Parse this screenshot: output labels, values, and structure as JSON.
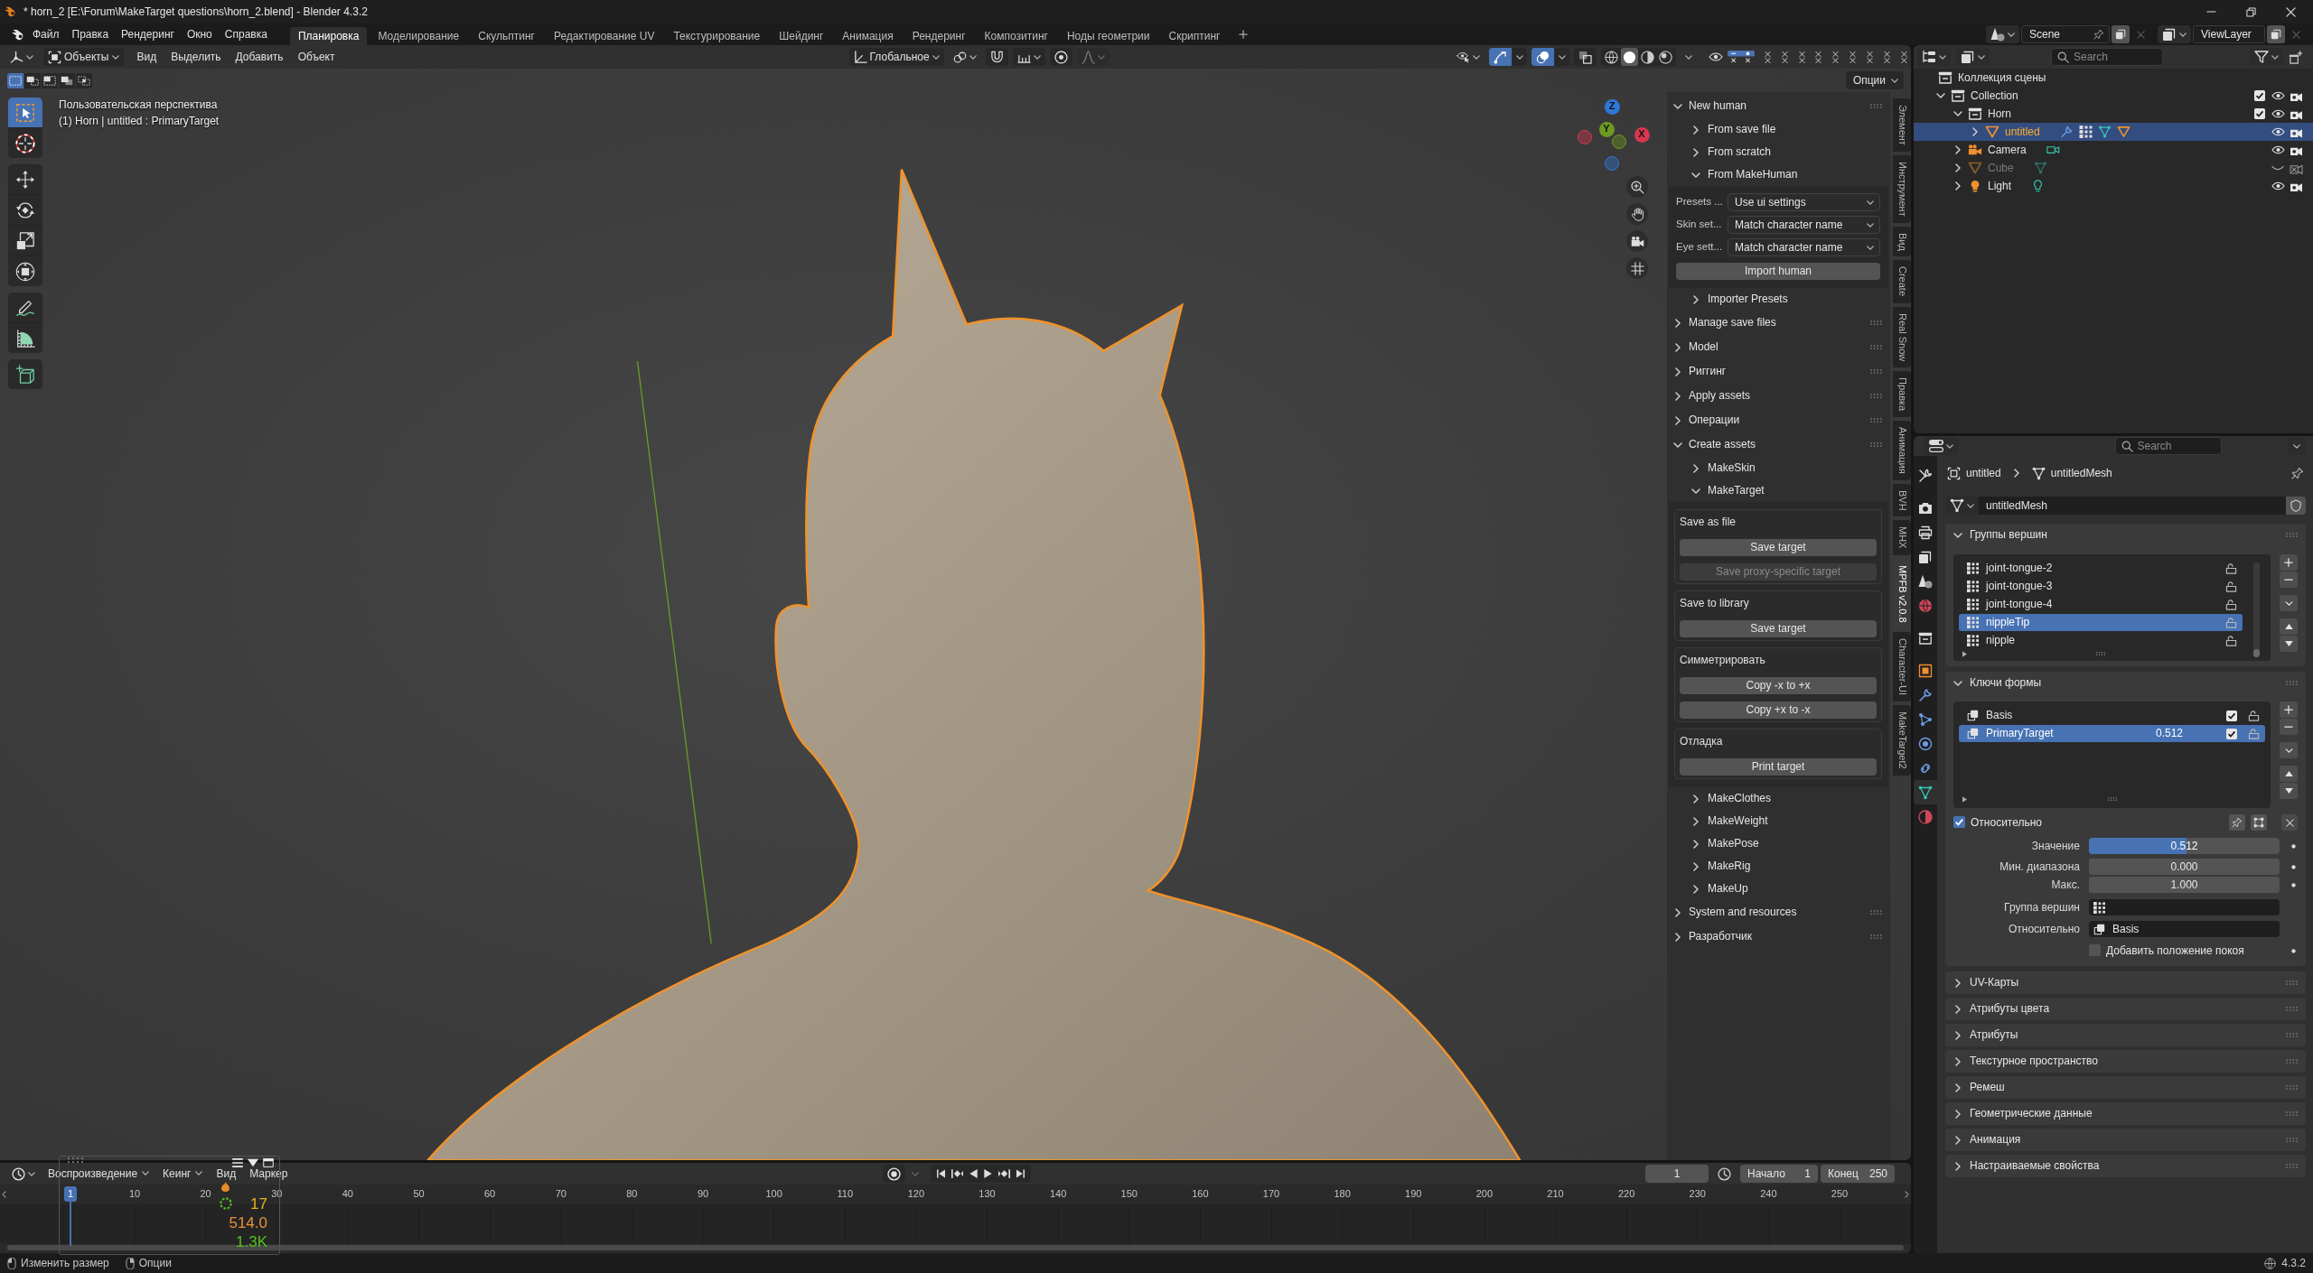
{
  "window": {
    "title": "* horn_2 [E:\\Forum\\MakeTarget questions\\horn_2.blend] - Blender 4.3.2"
  },
  "menu": [
    "Файл",
    "Правка",
    "Рендеринг",
    "Окно",
    "Справка"
  ],
  "workspaces": [
    {
      "label": "Планировка",
      "selected": true
    },
    {
      "label": "Моделирование",
      "selected": false
    },
    {
      "label": "Скульптинг",
      "selected": false
    },
    {
      "label": "Редактирование UV",
      "selected": false
    },
    {
      "label": "Текстурирование",
      "selected": false
    },
    {
      "label": "Шейдинг",
      "selected": false
    },
    {
      "label": "Анимация",
      "selected": false
    },
    {
      "label": "Рендеринг",
      "selected": false
    },
    {
      "label": "Композитинг",
      "selected": false
    },
    {
      "label": "Ноды геометрии",
      "selected": false
    },
    {
      "label": "Скриптинг",
      "selected": false
    }
  ],
  "scene": {
    "name": "Scene"
  },
  "view_layer": {
    "name": "ViewLayer"
  },
  "viewport": {
    "mode": "Объекты",
    "menus": [
      "Вид",
      "Выделить",
      "Добавить",
      "Объект"
    ],
    "orientation": "Глобальное",
    "toggles": [
      {
        "kind": "gizmo",
        "on": true
      },
      {
        "kind": "overlays",
        "on": true
      },
      {
        "kind": "xray",
        "on": false
      }
    ],
    "shading": [
      {
        "kind": "wireframe",
        "selected": false
      },
      {
        "kind": "solid",
        "selected": true
      },
      {
        "kind": "material",
        "selected": false
      },
      {
        "kind": "rendered",
        "selected": false
      }
    ],
    "options": "Опции",
    "select_modes": [
      {
        "kind": "new",
        "selected": true
      },
      {
        "kind": "extend",
        "selected": false
      },
      {
        "kind": "subtract",
        "selected": false
      },
      {
        "kind": "invert",
        "selected": false
      },
      {
        "kind": "intersect",
        "selected": false
      }
    ],
    "tool_groups": [
      [
        {
          "kind": "select_box",
          "selected": true
        },
        {
          "kind": "cursor",
          "selected": false
        }
      ],
      [
        {
          "kind": "move",
          "selected": false
        },
        {
          "kind": "rotate",
          "selected": false
        },
        {
          "kind": "scale",
          "selected": false
        },
        {
          "kind": "transform",
          "selected": false
        }
      ],
      [
        {
          "kind": "annotate",
          "selected": false
        },
        {
          "kind": "measure",
          "selected": false
        }
      ],
      [
        {
          "kind": "add_cube",
          "selected": false
        }
      ]
    ],
    "info": [
      "Пользовательская перспектива",
      "(1) Horn | untitled : PrimaryTarget"
    ],
    "axes": [
      {
        "label": "Z",
        "color": "#2f78d8"
      },
      {
        "label": "Y",
        "color": "#6c9a22"
      },
      {
        "label": "X",
        "color": "#d8364e"
      }
    ],
    "sidebar": {
      "panels": [
        {
          "title": "New human",
          "expanded": true,
          "children": [
            {
              "title": "From save file",
              "expanded": false
            },
            {
              "title": "From scratch",
              "expanded": false
            },
            {
              "title": "From MakeHuman",
              "expanded": true,
              "fields": [
                {
                  "label": "Presets ...",
                  "value": "Use ui settings"
                },
                {
                  "label": "Skin set...",
                  "value": "Match character name"
                },
                {
                  "label": "Eye sett...",
                  "value": "Match character name"
                }
              ],
              "buttons": [
                {
                  "label": "Import human",
                  "disabled": false
                }
              ]
            },
            {
              "title": "Importer Presets",
              "expanded": false
            }
          ]
        },
        {
          "title": "Manage save files",
          "expanded": false
        },
        {
          "title": "Model",
          "expanded": false
        },
        {
          "title": "Риггинг",
          "expanded": false
        },
        {
          "title": "Apply assets",
          "expanded": false
        },
        {
          "title": "Операции",
          "expanded": false
        },
        {
          "title": "Create assets",
          "expanded": true,
          "children": [
            {
              "title": "MakeSkin",
              "expanded": false
            },
            {
              "title": "MakeTarget",
              "expanded": true,
              "boxes": [
                {
                  "title": "Save as file",
                  "buttons": [
                    {
                      "label": "Save target",
                      "disabled": false
                    },
                    {
                      "label": "Save proxy-specific target",
                      "disabled": true
                    }
                  ]
                },
                {
                  "title": "Save to library",
                  "buttons": [
                    {
                      "label": "Save target",
                      "disabled": false
                    }
                  ]
                },
                {
                  "title": "Симметрировать",
                  "buttons": [
                    {
                      "label": "Copy -x to +x",
                      "disabled": false
                    },
                    {
                      "label": "Copy +x to -x",
                      "disabled": false
                    }
                  ]
                },
                {
                  "title": "Отладка",
                  "buttons": [
                    {
                      "label": "Print target",
                      "disabled": false
                    }
                  ]
                }
              ]
            },
            {
              "title": "MakeClothes",
              "expanded": false
            },
            {
              "title": "MakeWeight",
              "expanded": false
            },
            {
              "title": "MakePose",
              "expanded": false
            },
            {
              "title": "MakeRig",
              "expanded": false
            },
            {
              "title": "MakeUp",
              "expanded": false
            }
          ]
        },
        {
          "title": "System and resources",
          "expanded": false
        },
        {
          "title": "Разработчик",
          "expanded": false
        }
      ],
      "tabs": [
        {
          "label": "Элемент",
          "selected": false
        },
        {
          "label": "Инструмент",
          "selected": false
        },
        {
          "label": "Вид",
          "selected": false
        },
        {
          "label": "Create",
          "selected": false
        },
        {
          "label": "Real Snow",
          "selected": false
        },
        {
          "label": "Правка",
          "selected": false
        },
        {
          "label": "Анимация",
          "selected": false
        },
        {
          "label": "BVH",
          "selected": false
        },
        {
          "label": "MHX",
          "selected": false
        },
        {
          "label": "MPFB v2.0.8",
          "selected": true
        },
        {
          "label": "Character-UI",
          "selected": false
        },
        {
          "label": "MakeTarget2",
          "selected": false
        }
      ]
    }
  },
  "outliner": {
    "search": {
      "placeholder": "Search"
    },
    "root": {
      "name": "Коллекция сцены"
    },
    "tree": [
      {
        "name": "Collection",
        "kind": "collection",
        "expanded": true,
        "selected": false,
        "checked": true,
        "hidden": false,
        "renderable": true,
        "children": [
          {
            "name": "Horn",
            "kind": "collection",
            "expanded": true,
            "selected": false,
            "checked": true,
            "hidden": false,
            "renderable": true,
            "children": [
              {
                "name": "untitled",
                "kind": "mesh",
                "expanded": false,
                "selected": true,
                "hidden": false,
                "renderable": true,
                "extras": [
                  {
                    "kind": "modifier"
                  },
                  {
                    "kind": "vertex_groups"
                  },
                  {
                    "kind": "mesh_data"
                  },
                  {
                    "kind": "mesh_object"
                  }
                ]
              }
            ]
          },
          {
            "name": "Camera",
            "kind": "camera",
            "expanded": false,
            "selected": false,
            "hidden": false,
            "renderable": true,
            "extras": [
              {
                "kind": "camera_data"
              }
            ]
          },
          {
            "name": "Cube",
            "kind": "mesh",
            "expanded": false,
            "selected": false,
            "hidden": true,
            "renderable": false,
            "extras": [
              {
                "kind": "mesh_data"
              }
            ]
          },
          {
            "name": "Light",
            "kind": "light",
            "expanded": false,
            "selected": false,
            "hidden": false,
            "renderable": true,
            "extras": [
              {
                "kind": "light_data"
              }
            ]
          }
        ]
      }
    ]
  },
  "properties": {
    "search": {
      "placeholder": "Search"
    },
    "tabs": [
      {
        "kind": "tool",
        "selected": false
      },
      {
        "kind": "render",
        "selected": false
      },
      {
        "kind": "output",
        "selected": false
      },
      {
        "kind": "view_layer",
        "selected": false
      },
      {
        "kind": "scene",
        "selected": false
      },
      {
        "kind": "world",
        "selected": false
      },
      {
        "kind": "collection",
        "selected": false
      },
      {
        "kind": "object",
        "selected": false
      },
      {
        "kind": "modifiers",
        "selected": false
      },
      {
        "kind": "particles",
        "selected": false
      },
      {
        "kind": "physics",
        "selected": false
      },
      {
        "kind": "constraints",
        "selected": false
      },
      {
        "kind": "data",
        "selected": true
      },
      {
        "kind": "material",
        "selected": false
      }
    ],
    "breadcrumb": {
      "object": "untitled",
      "data": "untitledMesh"
    },
    "datablock": {
      "value": "untitledMesh"
    },
    "panels": [
      {
        "title": "Группы вершин",
        "expanded": true,
        "kind": "vertex_groups",
        "items": [
          {
            "name": "joint-tongue-2",
            "selected": false
          },
          {
            "name": "joint-tongue-3",
            "selected": false
          },
          {
            "name": "joint-tongue-4",
            "selected": false
          },
          {
            "name": "nippleTip",
            "selected": true
          },
          {
            "name": "nipple",
            "selected": false
          }
        ]
      },
      {
        "title": "Ключи формы",
        "expanded": true,
        "kind": "shape_keys",
        "items": [
          {
            "name": "Basis",
            "selected": false,
            "checked": true
          },
          {
            "name": "PrimaryTarget",
            "value": "0.512",
            "selected": true,
            "checked": true
          }
        ],
        "relative": {
          "label": "Относительно",
          "checked": true
        },
        "fields": [
          {
            "kind": "slider",
            "label": "Значение",
            "value": "0.512",
            "level": 0.512
          },
          {
            "kind": "number",
            "label": "Мин. диапазона",
            "value": "0.000"
          },
          {
            "kind": "number",
            "label": "Макс.",
            "value": "1.000"
          },
          {
            "kind": "vertex_group",
            "label": "Группа вершин"
          },
          {
            "kind": "shape_key",
            "label": "Относительно",
            "value": "Basis"
          }
        ],
        "rest": {
          "label": "Добавить положение покоя",
          "checked": false
        }
      },
      {
        "title": "UV-Карты",
        "expanded": false
      },
      {
        "title": "Атрибуты цвета",
        "expanded": false
      },
      {
        "title": "Атрибуты",
        "expanded": false
      },
      {
        "title": "Текстурное пространство",
        "expanded": false
      },
      {
        "title": "Ремеш",
        "expanded": false
      },
      {
        "title": "Геометрические данные",
        "expanded": false
      },
      {
        "title": "Анимация",
        "expanded": false
      },
      {
        "title": "Настраиваемые свойства",
        "expanded": false
      }
    ]
  },
  "timeline": {
    "menus": [
      {
        "label": "Воспроизведение",
        "kind": "dropdown"
      },
      {
        "label": "Кеинг",
        "kind": "dropdown"
      },
      {
        "label": "Вид",
        "kind": "menu"
      },
      {
        "label": "Маркер",
        "kind": "menu"
      }
    ],
    "current_frame": "1",
    "start": {
      "label": "Начало",
      "value": "1"
    },
    "end": {
      "label": "Конец",
      "value": "250"
    },
    "playhead": "1",
    "ticks": [
      "10",
      "20",
      "30",
      "40",
      "50",
      "60",
      "70",
      "80",
      "90",
      "100",
      "110",
      "120",
      "130",
      "140",
      "150",
      "160",
      "170",
      "180",
      "190",
      "200",
      "210",
      "220",
      "230",
      "240",
      "250"
    ],
    "stats": [
      {
        "value": "17",
        "color": "#e6b422"
      },
      {
        "value": "514.0",
        "color": "#e8923a"
      },
      {
        "value": "1.3K",
        "color": "#52c41a"
      }
    ]
  },
  "status_bar": {
    "hints": [
      {
        "kind": "drag",
        "label": "Изменить размер"
      },
      {
        "kind": "right_click",
        "label": "Опции"
      }
    ],
    "version": "4.3.2"
  }
}
